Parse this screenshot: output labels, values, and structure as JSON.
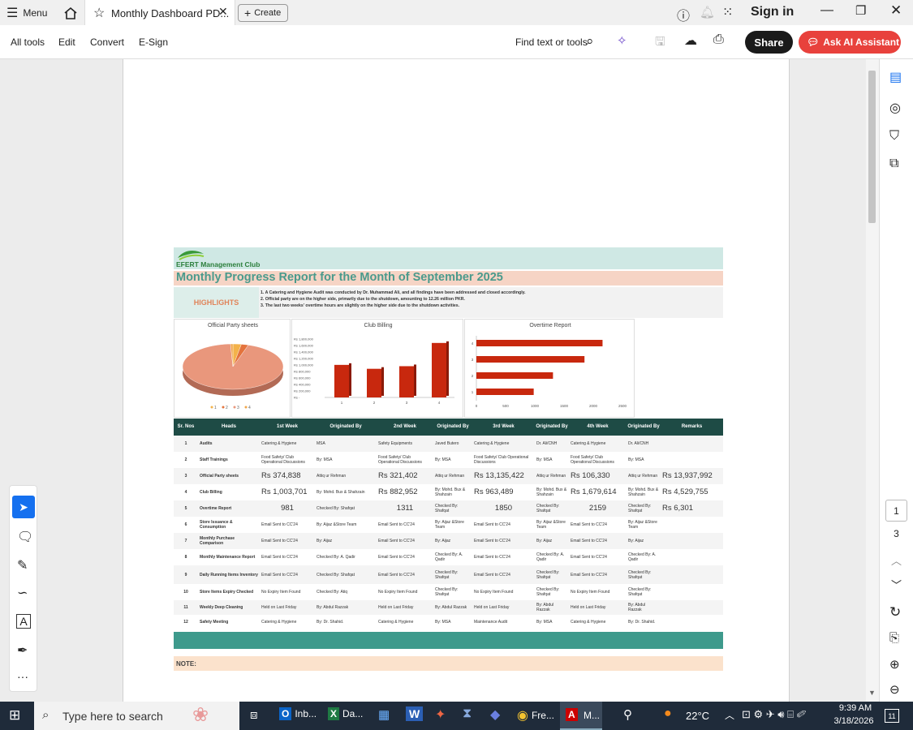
{
  "titlebar": {
    "menu_label": "Menu",
    "tab_title": "Monthly Dashboard PD...",
    "create_label": "Create",
    "sign_in": "Sign in"
  },
  "menubar": {
    "items": [
      "All tools",
      "Edit",
      "Convert",
      "E-Sign"
    ],
    "find_label": "Find text or tools",
    "share": "Share",
    "ask_ai": "Ask AI Assistant"
  },
  "pager": {
    "current": "1",
    "total": "3"
  },
  "report": {
    "org_name": "EFERT Management Club",
    "title": "Monthly Progress Report for the Month of September 2025",
    "highlights_label": "HIGHLIGHTS",
    "highlights": [
      "1. A Catering and Hygiene Audit was conducted by Dr. Muhammad Ali, and all findings have been addressed and closed accordingly.",
      "2. Official party are on the higher side, primarily due to the shutdown, amounting to 12.26 million PKR.",
      "3. The last two weeks' overtime hours are slightly on the higher side due to the shutdown activities."
    ],
    "note_label": "NOTE:",
    "headers": [
      "Sr. Nos",
      "Heads",
      "1st Week",
      "Originated By",
      "2nd Week",
      "Originated By",
      "3rd Week",
      "Originated By",
      "4th Week",
      "Originated By",
      "Remarks"
    ],
    "rows": [
      [
        "1",
        "Audits",
        "Catering & Hygiene",
        "MSA",
        "Safety Equipments",
        "Javed Butero",
        "Catering & Hygiene",
        "Dr. Ali/CNH",
        "Catering & Hygiene",
        "Dr. Ali/CNH",
        ""
      ],
      [
        "2",
        "Staff Trainings",
        "Food Safety/ Club Operational Discussions",
        "By: MSA",
        "Food Safety/ Club Operational Discussions",
        "By: MSA",
        "Food Safety/ Club Operational Discussions",
        "By: MSA",
        "Food Safety/ Club Operational Discussions",
        "By: MSA",
        ""
      ],
      [
        "3",
        "Official Party sheets",
        "Rs 374,838",
        "Attiq ur Rehman",
        "Rs 321,402",
        "Attiq ur Rehman",
        "Rs 13,135,422",
        "Attiq ur Rehman",
        "Rs 106,330",
        "Attiq ur Rehman",
        "Rs 13,937,992"
      ],
      [
        "4",
        "Club Billing",
        "Rs 1,003,701",
        "By: Mohd. Bux & Shahzain",
        "Rs 882,952",
        "By: Mohd. Bux & Shahzain",
        "Rs 963,489",
        "By: Mohd. Bux & Shahzain",
        "Rs 1,679,614",
        "By: Mohd. Bux & Shahzain",
        "Rs 4,529,755"
      ],
      [
        "5",
        "Overtime Report",
        "981",
        "Checked By: Shafqat",
        "1311",
        "Checked By: Shafqat",
        "1850",
        "Checked By: Shafqat",
        "2159",
        "Checked By: Shafqat",
        "Rs 6,301"
      ],
      [
        "6",
        "Store Issuance & Consumption",
        "Email Sent to CC'24",
        "By: Aijaz &Store Team",
        "Email Sent to CC'24",
        "By: Aijaz &Store Team",
        "Email Sent to CC'24",
        "By: Aijaz &Store Team",
        "Email Sent to CC'24",
        "By: Aijaz &Store Team",
        ""
      ],
      [
        "7",
        "Monthly Purchase Comparison",
        "Email Sent to CC'24",
        "By: Aijaz",
        "Email Sent to CC'24",
        "By: Aijaz",
        "Email Sent to CC'24",
        "By: Aijaz",
        "Email Sent to CC'24",
        "By: Aijaz",
        ""
      ],
      [
        "8",
        "Monthly Maintenance Report",
        "Email Sent to CC'24",
        "Checked By: A. Qadir",
        "Email Sent to CC'24",
        "Checked By: A. Qadir",
        "Email Sent to CC'24",
        "Checked By: A. Qadir",
        "Email Sent to CC'24",
        "Checked By: A. Qadir",
        ""
      ],
      [
        "9",
        "Daily Running Items Inventory",
        "Email Sent to CC'24",
        "Checked By: Shafqat",
        "Email Sent to CC'24",
        "Checked By: Shafqat",
        "Email Sent to CC'24",
        "Checked By: Shafqat",
        "Email Sent to CC'24",
        "Checked By: Shafqat",
        ""
      ],
      [
        "10",
        "Store Items Expiry Checked",
        "No Expiry Item Found",
        "Checked By: Atiq",
        "No Expiry Item Found",
        "Checked By: Shafqat",
        "No Expiry Item Found",
        "Checked By: Shafqat",
        "No Expiry Item Found",
        "Checked By: Shafqat",
        ""
      ],
      [
        "11",
        "Weekly Deep Cleaning",
        "Held on Last Friday",
        "By: Abdul Razzak",
        "Held on Last Friday",
        "By: Abdul Razzak",
        "Held on Last Friday",
        "By: Abdul Razzak",
        "Held on Last Friday",
        "By: Abdul Razzak",
        ""
      ],
      [
        "12",
        "Safety Meeting",
        "Catering & Hygiene",
        "By: Dr. Shahid.",
        "Catering & Hygiene",
        "By: MSA",
        "Maintenance Audit",
        "By: MSA",
        "Catering & Hygiene",
        "By: Dr. Shahid.",
        ""
      ]
    ]
  },
  "chart_data": [
    {
      "type": "pie",
      "title": "Official Party sheets",
      "categories": [
        "1",
        "2",
        "3",
        "4"
      ],
      "values": [
        374838,
        321402,
        13135422,
        106330
      ],
      "legend": "bottom"
    },
    {
      "type": "bar",
      "title": "Club Billing",
      "categories": [
        "1",
        "2",
        "3",
        "4"
      ],
      "values": [
        1003701,
        882952,
        963489,
        1679614
      ],
      "ylim": [
        0,
        1800000
      ],
      "yticks": [
        "Rs 1,800,000",
        "Rs 1,600,000",
        "Rs 1,400,000",
        "Rs 1,200,000",
        "Rs 1,000,000",
        "Rs 800,000",
        "Rs 600,000",
        "Rs 400,000",
        "Rs 200,000",
        "Rs -"
      ]
    },
    {
      "type": "bar",
      "orientation": "horizontal",
      "title": "Overtime Report",
      "categories": [
        "1",
        "2",
        "3",
        "4"
      ],
      "values": [
        981,
        1311,
        1850,
        2159
      ],
      "xlim": [
        0,
        2500
      ],
      "xticks": [
        "0",
        "500",
        "1000",
        "1500",
        "2000",
        "2500"
      ]
    }
  ],
  "taskbar": {
    "search_placeholder": "Type here to search",
    "apps": [
      "Inb...",
      "Da...",
      "Fre...",
      "M..."
    ],
    "temp": "22°C",
    "time": "9:39 AM",
    "date": "3/18/2026",
    "notif_count": "11"
  },
  "colors": {
    "accent_red": "#e8413c",
    "teal": "#1e4b45",
    "bar": "#c8280e"
  }
}
